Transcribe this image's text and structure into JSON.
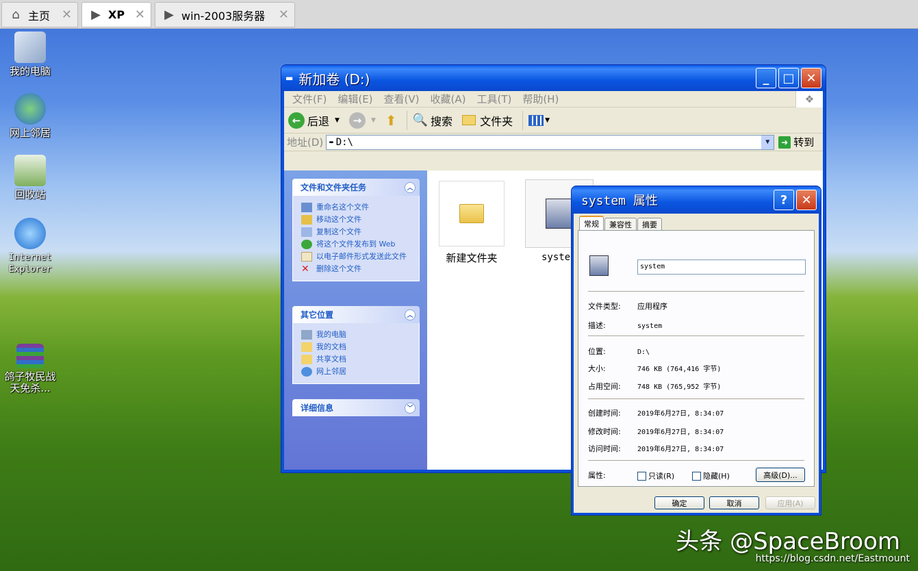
{
  "host_tabs": [
    {
      "label": "主页",
      "icon": "home-icon"
    },
    {
      "label": "XP",
      "icon": "vm-icon"
    },
    {
      "label": "win-2003服务器",
      "icon": "vm-icon"
    }
  ],
  "desktop_icons": [
    "我的电脑",
    "网上邻居",
    "回收站",
    "Internet Explorer",
    "鸽子牧民战天免杀..."
  ],
  "explorer": {
    "title": "新加卷 (D:)",
    "menu": [
      "文件(F)",
      "编辑(E)",
      "查看(V)",
      "收藏(A)",
      "工具(T)",
      "帮助(H)"
    ],
    "toolbar": {
      "back": "后退",
      "search": "搜索",
      "folders": "文件夹"
    },
    "address_label": "地址(D)",
    "address_value": "D:\\",
    "go_label": "转到",
    "tasks_title": "文件和文件夹任务",
    "tasks": [
      "重命名这个文件",
      "移动这个文件",
      "复制这个文件",
      "将这个文件发布到 Web",
      "以电子邮件形式发送此文件",
      "删除这个文件"
    ],
    "places_title": "其它位置",
    "places": [
      "我的电脑",
      "我的文档",
      "共享文档",
      "网上邻居"
    ],
    "details_title": "详细信息",
    "files": [
      {
        "name": "新建文件夹"
      },
      {
        "name": "syste"
      }
    ]
  },
  "properties": {
    "title": "system 属性",
    "tabs": [
      "常规",
      "兼容性",
      "摘要"
    ],
    "name": "system",
    "file_type_label": "文件类型:",
    "file_type": "应用程序",
    "desc_label": "描述:",
    "desc": "system",
    "location_label": "位置:",
    "location": "D:\\",
    "size_label": "大小:",
    "size": "746 KB (764,416 字节)",
    "size_on_disk_label": "占用空间:",
    "size_on_disk": "748 KB (765,952 字节)",
    "created_label": "创建时间:",
    "created": "2019年6月27日, 8:34:07",
    "modified_label": "修改时间:",
    "modified": "2019年6月27日, 8:34:07",
    "accessed_label": "访问时间:",
    "accessed": "2019年6月27日, 8:34:07",
    "attributes_label": "属性:",
    "readonly_label": "只读(R)",
    "hidden_label": "隐藏(H)",
    "advanced_label": "高级(D)...",
    "ok_label": "确定",
    "cancel_label": "取消",
    "apply_label": "应用(A)"
  },
  "watermark": "头条 @SpaceBroom",
  "watermark_url": "https://blog.csdn.net/Eastmount"
}
